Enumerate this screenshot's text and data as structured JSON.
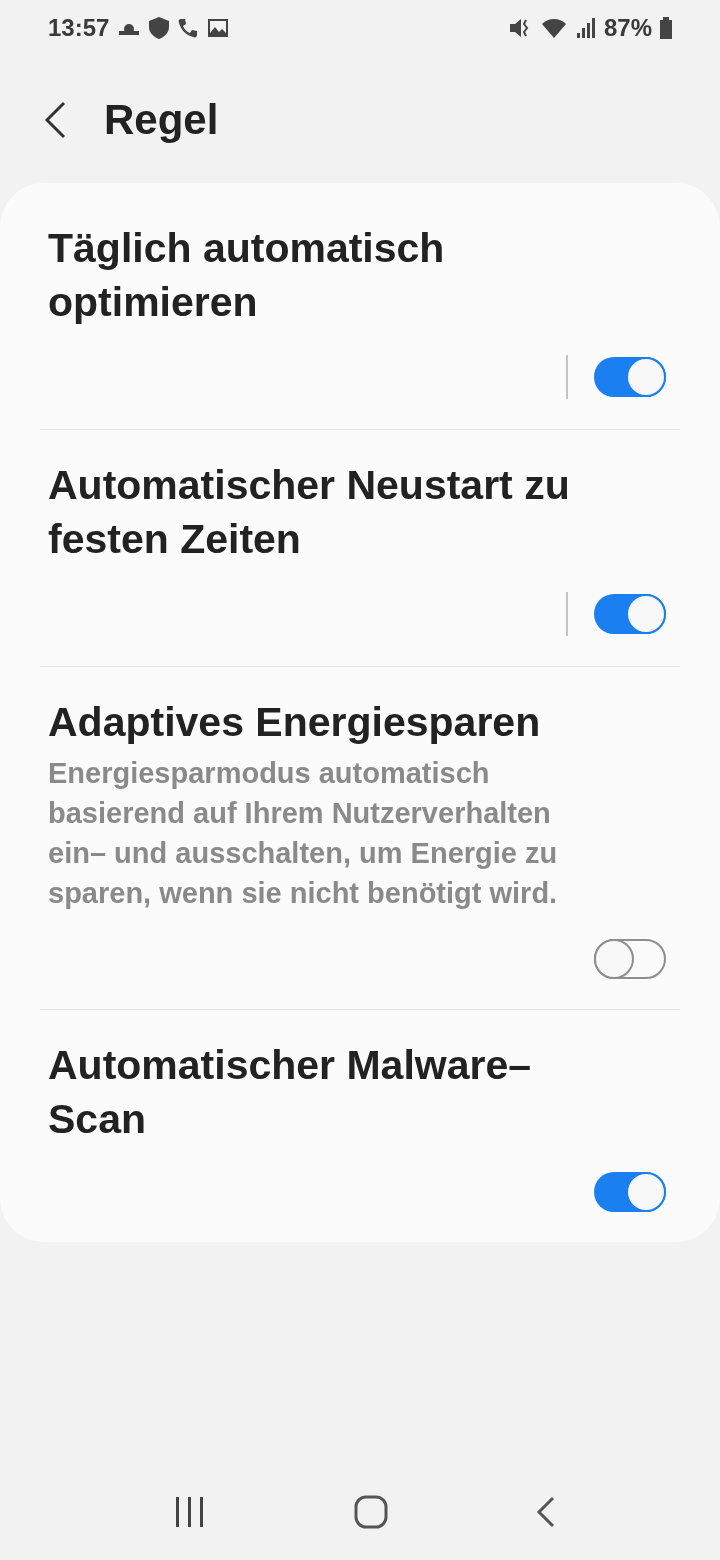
{
  "status_bar": {
    "time": "13:57",
    "battery": "87%"
  },
  "header": {
    "title": "Regel"
  },
  "settings": [
    {
      "title": "Täglich automatisch optimieren",
      "separator": true,
      "on": true
    },
    {
      "title": "Automatischer Neustart zu festen Zeiten",
      "separator": true,
      "on": true
    },
    {
      "title": "Adaptives Energiesparen",
      "description": "Energiesparmodus automatisch basierend auf Ihrem Nutzerverhalten ein– und ausschalten, um Energie zu sparen, wenn sie nicht benötigt wird.",
      "separator": false,
      "on": false
    },
    {
      "title": "Automatischer Malware–Scan",
      "separator": false,
      "on": true
    }
  ]
}
